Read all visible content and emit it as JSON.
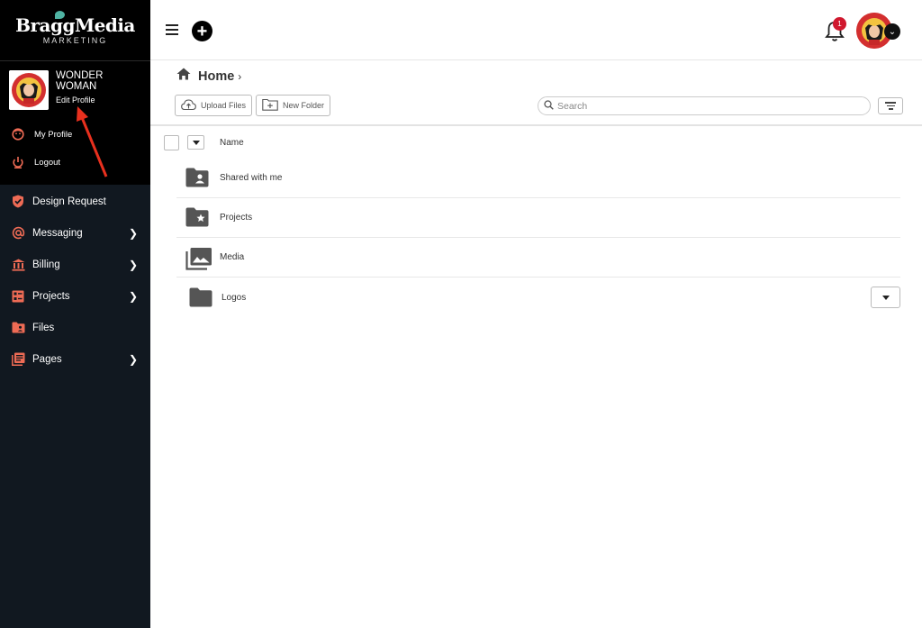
{
  "brand": {
    "name": "BraggMedia",
    "subtitle": "MARKETING"
  },
  "profile": {
    "name": "WONDER WOMAN",
    "edit_label": "Edit Profile",
    "menu": [
      {
        "label": "My Profile",
        "icon": "face-icon"
      },
      {
        "label": "Logout",
        "icon": "power-icon"
      }
    ]
  },
  "sidebar": {
    "items": [
      {
        "label": "Design Request",
        "icon": "shield-check-icon",
        "has_submenu": false
      },
      {
        "label": "Messaging",
        "icon": "at-icon",
        "has_submenu": true
      },
      {
        "label": "Billing",
        "icon": "bank-icon",
        "has_submenu": true
      },
      {
        "label": "Projects",
        "icon": "project-icon",
        "has_submenu": true
      },
      {
        "label": "Files",
        "icon": "folder-user-icon",
        "has_submenu": false
      },
      {
        "label": "Pages",
        "icon": "pages-icon",
        "has_submenu": true
      }
    ],
    "accent_color": "#ee6b55"
  },
  "topbar": {
    "notification_count": "1"
  },
  "main": {
    "breadcrumb": {
      "title": "Home"
    },
    "toolbar": {
      "upload_label": "Upload Files",
      "new_folder_label": "New Folder",
      "search_placeholder": "Search"
    },
    "list_header": {
      "name_col": "Name"
    },
    "rows": [
      {
        "name": "Shared with me",
        "icon": "shared-folder-icon"
      },
      {
        "name": "Projects",
        "icon": "starred-folder-icon"
      },
      {
        "name": "Media",
        "icon": "media-library-icon"
      },
      {
        "name": "Logos",
        "icon": "folder-icon"
      }
    ]
  }
}
